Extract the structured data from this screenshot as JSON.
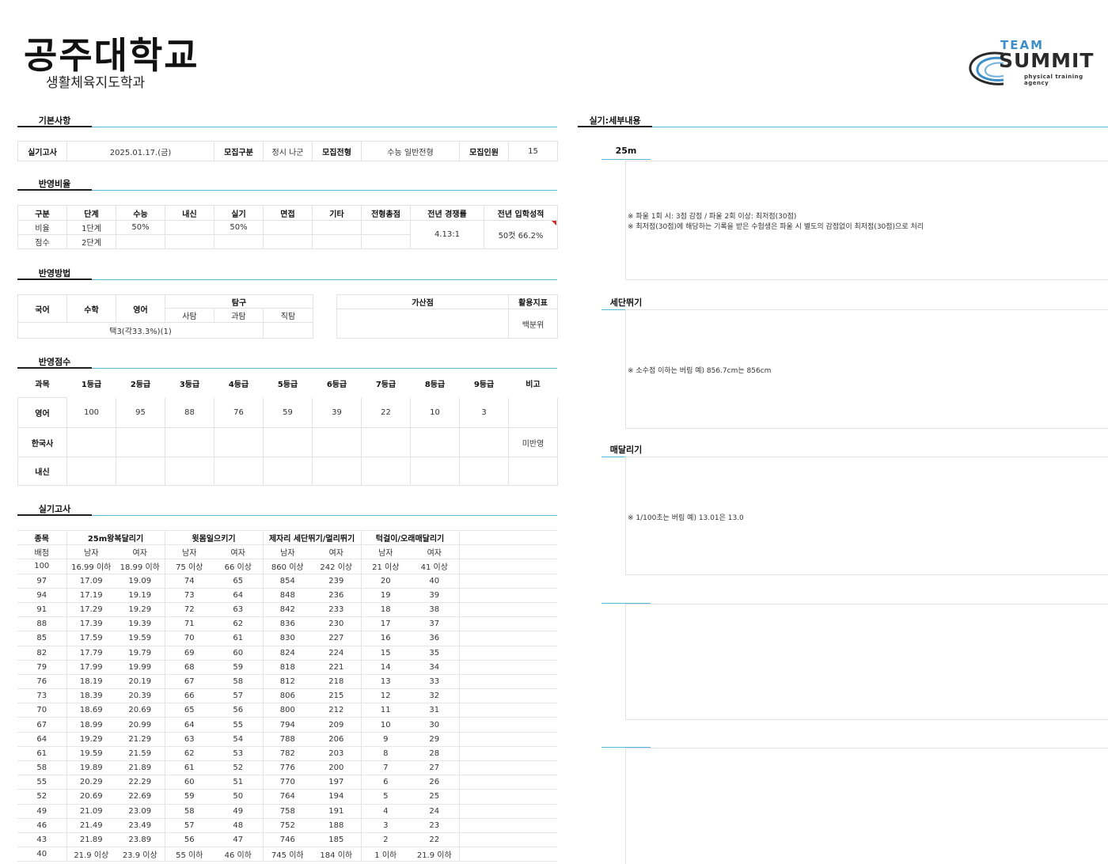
{
  "header": {
    "title": "공주대학교",
    "subtitle": "생활체육지도학과",
    "logo": {
      "team": "TEAM",
      "summit": "SUMMIT",
      "tagline": "physical training agency"
    }
  },
  "sections": {
    "basic": "기본사항",
    "ratio": "반영비율",
    "method": "반영방법",
    "score": "반영점수",
    "practical": "실기고사",
    "detail": "실기:세부내용"
  },
  "basic": {
    "exam_date_label": "실기고사",
    "exam_date": "2025.01.17.(금)",
    "recruit_type_label": "모집구분",
    "recruit_type": "정시 나군",
    "admission_label": "모집전형",
    "admission": "수능 일반전형",
    "quota_label": "모집인원",
    "quota": "15"
  },
  "ratio": {
    "headers": [
      "구분",
      "단계",
      "수능",
      "내신",
      "실기",
      "면접",
      "기타",
      "전형총점",
      "전년 경쟁률",
      "전년 입학성적"
    ],
    "row1": {
      "label": "비율",
      "stage": "1단계",
      "suneung": "50%",
      "practical": "50%"
    },
    "row2": {
      "label": "점수",
      "stage": "2단계"
    },
    "competition": "4.13:1",
    "last_score": "50컷 66.2%"
  },
  "method": {
    "korean": "국어",
    "math": "수학",
    "english": "영어",
    "inquiry": "탐구",
    "social": "사탐",
    "science": "과탐",
    "vocational": "직탐",
    "bonus": "가산점",
    "index": "활용지표",
    "selection": "택3(각33.3%)(1)",
    "index_value": "백분위"
  },
  "score": {
    "headers": [
      "과목",
      "1등급",
      "2등급",
      "3등급",
      "4등급",
      "5등급",
      "6등급",
      "7등급",
      "8등급",
      "9등급",
      "비고"
    ],
    "english": {
      "label": "영어",
      "values": [
        "100",
        "95",
        "88",
        "76",
        "59",
        "39",
        "22",
        "10",
        "3"
      ]
    },
    "history": {
      "label": "한국사",
      "note": "미반영"
    },
    "gpa": {
      "label": "내신"
    }
  },
  "practical": {
    "headers": [
      "종목",
      "25m왕복달리기",
      "윗몸일으키기",
      "제자리 세단뛰기/멀리뛰기",
      "턱걸이/오래매달리기"
    ],
    "sub": [
      "배점",
      "남자",
      "여자",
      "남자",
      "여자",
      "남자",
      "여자",
      "남자",
      "여자"
    ],
    "rows": [
      [
        "100",
        "16.99 이하",
        "18.99 이하",
        "75 이상",
        "66 이상",
        "860 이상",
        "242 이상",
        "21 이상",
        "41 이상"
      ],
      [
        "97",
        "17.09",
        "19.09",
        "74",
        "65",
        "854",
        "239",
        "20",
        "40"
      ],
      [
        "94",
        "17.19",
        "19.19",
        "73",
        "64",
        "848",
        "236",
        "19",
        "39"
      ],
      [
        "91",
        "17.29",
        "19.29",
        "72",
        "63",
        "842",
        "233",
        "18",
        "38"
      ],
      [
        "88",
        "17.39",
        "19.39",
        "71",
        "62",
        "836",
        "230",
        "17",
        "37"
      ],
      [
        "85",
        "17.59",
        "19.59",
        "70",
        "61",
        "830",
        "227",
        "16",
        "36"
      ],
      [
        "82",
        "17.79",
        "19.79",
        "69",
        "60",
        "824",
        "224",
        "15",
        "35"
      ],
      [
        "79",
        "17.99",
        "19.99",
        "68",
        "59",
        "818",
        "221",
        "14",
        "34"
      ],
      [
        "76",
        "18.19",
        "20.19",
        "67",
        "58",
        "812",
        "218",
        "13",
        "33"
      ],
      [
        "73",
        "18.39",
        "20.39",
        "66",
        "57",
        "806",
        "215",
        "12",
        "32"
      ],
      [
        "70",
        "18.69",
        "20.69",
        "65",
        "56",
        "800",
        "212",
        "11",
        "31"
      ],
      [
        "67",
        "18.99",
        "20.99",
        "64",
        "55",
        "794",
        "209",
        "10",
        "30"
      ],
      [
        "64",
        "19.29",
        "21.29",
        "63",
        "54",
        "788",
        "206",
        "9",
        "29"
      ],
      [
        "61",
        "19.59",
        "21.59",
        "62",
        "53",
        "782",
        "203",
        "8",
        "28"
      ],
      [
        "58",
        "19.89",
        "21.89",
        "61",
        "52",
        "776",
        "200",
        "7",
        "27"
      ],
      [
        "55",
        "20.29",
        "22.29",
        "60",
        "51",
        "770",
        "197",
        "6",
        "26"
      ],
      [
        "52",
        "20.69",
        "22.69",
        "59",
        "50",
        "764",
        "194",
        "5",
        "25"
      ],
      [
        "49",
        "21.09",
        "23.09",
        "58",
        "49",
        "758",
        "191",
        "4",
        "24"
      ],
      [
        "46",
        "21.49",
        "23.49",
        "57",
        "48",
        "752",
        "188",
        "3",
        "23"
      ],
      [
        "43",
        "21.89",
        "23.89",
        "56",
        "47",
        "746",
        "185",
        "2",
        "22"
      ],
      [
        "40",
        "21.9 이상",
        "23.9 이상",
        "55 이하",
        "46 이하",
        "745 이하",
        "184 이하",
        "1 이하",
        "21.9 이하"
      ]
    ]
  },
  "detail": {
    "run25": {
      "title": "25m",
      "lines": [
        "※ 파울 1회 시: 3점 감점 / 파울 2회 이상: 최저점(30점)",
        "※ 최저점(30점)에 해당하는 기록을 받은 수험생은 파울 시 별도의 감점없이 최저점(30점)으로 처리"
      ]
    },
    "jump": {
      "title": "세단뛰기",
      "lines": [
        "※ 소수점 이하는 버림   예) 856.7cm는 856cm"
      ]
    },
    "hang": {
      "title": "매달리기",
      "lines": [
        "※ 1/100초는 버림   예) 13.01은 13.0"
      ]
    }
  }
}
